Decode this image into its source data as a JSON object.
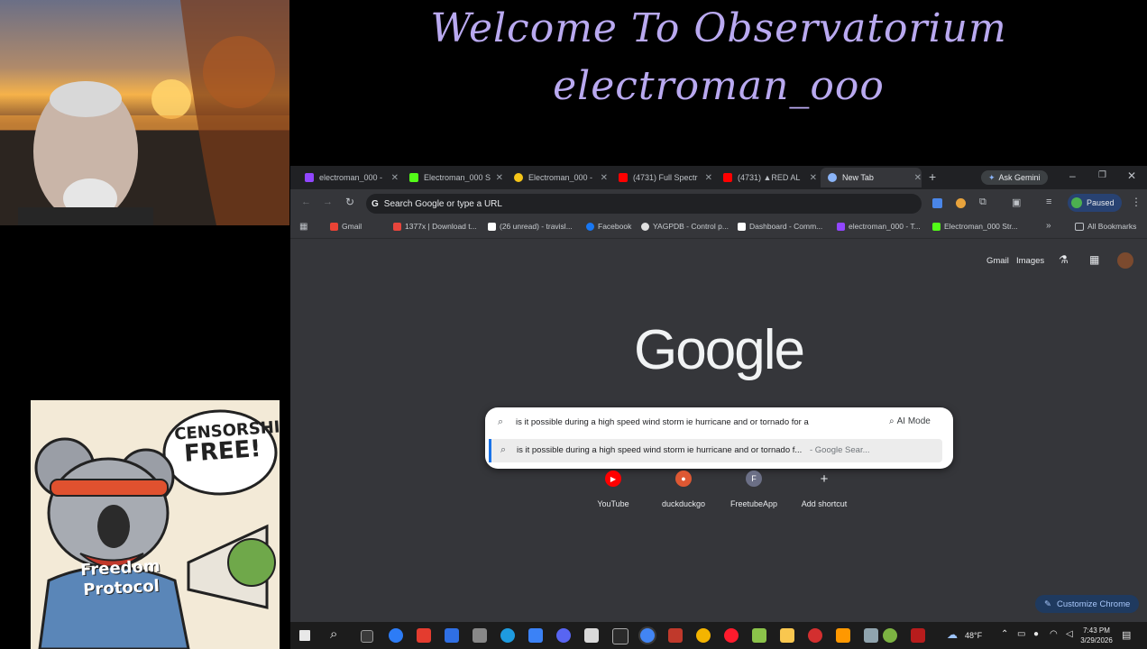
{
  "overlay": {
    "title_line1": "Welcome To Observatorium",
    "title_line2": "electroman_ooo"
  },
  "sticker": {
    "bubble_text_1": "CENSORSHIP",
    "bubble_text_2": "FREE!",
    "shirt_text_1": "Freedom",
    "shirt_text_2": "Protocol"
  },
  "browser": {
    "tabs": [
      {
        "label": "electroman_000 -",
        "favicon_color": "#9146ff",
        "active": false
      },
      {
        "label": "Electroman_000 S",
        "favicon_color": "#53fc18",
        "active": false
      },
      {
        "label": "Electroman_000 -",
        "favicon_color": "#f5c518",
        "active": false
      },
      {
        "label": "(4731) Full Spectr",
        "favicon_color": "#ff0000",
        "active": false
      },
      {
        "label": "(4731) ▲RED AL",
        "favicon_color": "#ff0000",
        "active": false
      },
      {
        "label": "New Tab",
        "favicon_color": "#8ab4f8",
        "active": true
      }
    ],
    "ask_gemini": "Ask Gemini",
    "omnibox_placeholder": "Search Google or type a URL",
    "profile_status": "Paused",
    "bookmarks": [
      {
        "label": "Gmail",
        "icon_color": "#ea4335"
      },
      {
        "label": "1377x | Download t...",
        "icon_color": "#e8453c"
      },
      {
        "label": "(26 unread) - travisl...",
        "icon_color": "#ffffff"
      },
      {
        "label": "Facebook",
        "icon_color": "#1877f2"
      },
      {
        "label": "YAGPDB - Control p...",
        "icon_color": "#e0e0e0"
      },
      {
        "label": "Dashboard - Comm...",
        "icon_color": "#ffffff"
      },
      {
        "label": "electroman_000 - T...",
        "icon_color": "#9146ff"
      },
      {
        "label": "Electroman_000 Str...",
        "icon_color": "#53fc18"
      }
    ],
    "all_bookmarks": "All Bookmarks",
    "ntp": {
      "gmail_link": "Gmail",
      "images_link": "Images",
      "logo_text": "Google",
      "search_query": "is it possible during a high speed wind storm ie hurricane and or tornado for a",
      "ai_mode": "AI Mode",
      "suggestion_text": "is it possible during a high speed wind storm ie hurricane and or tornado f...",
      "suggestion_suffix": "- Google Sear...",
      "shortcuts": [
        {
          "label": "YouTube",
          "color": "#ff0000",
          "glyph": "▶"
        },
        {
          "label": "duckduckgo",
          "color": "#de5833",
          "glyph": "●"
        },
        {
          "label": "FreetubeApp",
          "color": "#9aa0a6",
          "glyph": "F"
        },
        {
          "label": "Add shortcut",
          "color": "#35363a",
          "glyph": "+"
        }
      ],
      "customize": "Customize Chrome"
    }
  },
  "taskbar": {
    "temperature": "48°F",
    "time": "7:43 PM",
    "date": "3/29/2026"
  }
}
